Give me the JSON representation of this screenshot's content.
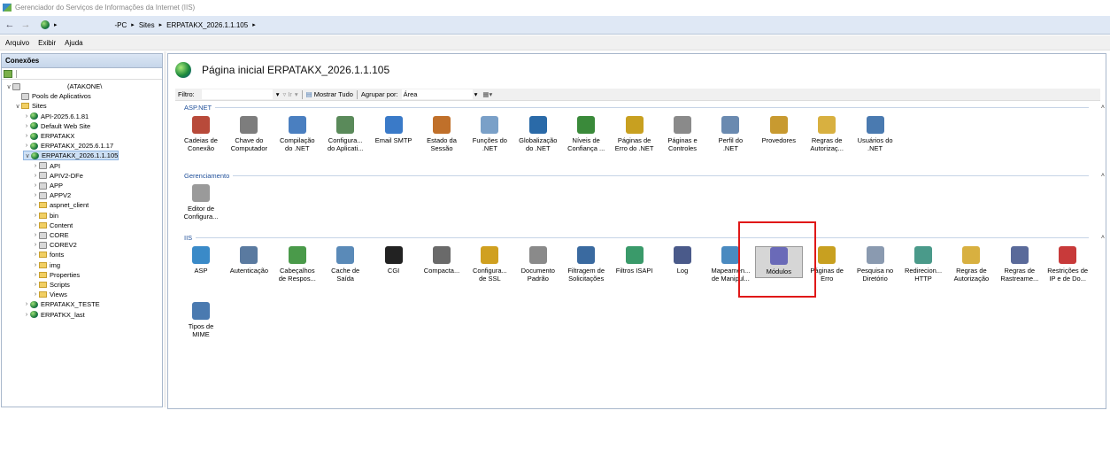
{
  "window": {
    "title": "Gerenciador do Serviços de Informações da Internet (IIS)"
  },
  "address": {
    "crumbs": [
      "-PC",
      "Sites",
      "ERPATAKX_2026.1.1.105"
    ]
  },
  "menu": [
    "Arquivo",
    "Exibir",
    "Ajuda"
  ],
  "connections": {
    "header": "Conexões",
    "tree": [
      {
        "label": "(ATAKONE\\",
        "indent": 0,
        "tog": "v",
        "icon": "server-icon"
      },
      {
        "label": "Pools de Aplicativos",
        "indent": 1,
        "tog": "",
        "icon": "app-pool-icon"
      },
      {
        "label": "Sites",
        "indent": 1,
        "tog": "v",
        "icon": "sites-folder-icon"
      },
      {
        "label": "API-2025.6.1.81",
        "indent": 2,
        "tog": ">",
        "icon": "globe-icon"
      },
      {
        "label": "Default Web Site",
        "indent": 2,
        "tog": ">",
        "icon": "globe-icon"
      },
      {
        "label": "ERPATAKX",
        "indent": 2,
        "tog": ">",
        "icon": "globe-icon"
      },
      {
        "label": "ERPATAKX_2025.6.1.17",
        "indent": 2,
        "tog": ">",
        "icon": "globe-icon"
      },
      {
        "label": "ERPATAKX_2026.1.1.105",
        "indent": 2,
        "tog": "v",
        "icon": "globe-icon",
        "selected": true
      },
      {
        "label": "API",
        "indent": 3,
        "tog": ">",
        "icon": "app-icon"
      },
      {
        "label": "APIV2-DFe",
        "indent": 3,
        "tog": ">",
        "icon": "app-icon"
      },
      {
        "label": "APP",
        "indent": 3,
        "tog": ">",
        "icon": "app-icon"
      },
      {
        "label": "APPV2",
        "indent": 3,
        "tog": ">",
        "icon": "app-icon"
      },
      {
        "label": "aspnet_client",
        "indent": 3,
        "tog": ">",
        "icon": "folder-icon"
      },
      {
        "label": "bin",
        "indent": 3,
        "tog": ">",
        "icon": "folder-icon"
      },
      {
        "label": "Content",
        "indent": 3,
        "tog": ">",
        "icon": "folder-icon"
      },
      {
        "label": "CORE",
        "indent": 3,
        "tog": ">",
        "icon": "app-icon"
      },
      {
        "label": "COREV2",
        "indent": 3,
        "tog": ">",
        "icon": "app-icon"
      },
      {
        "label": "fonts",
        "indent": 3,
        "tog": ">",
        "icon": "folder-icon"
      },
      {
        "label": "img",
        "indent": 3,
        "tog": ">",
        "icon": "folder-icon"
      },
      {
        "label": "Properties",
        "indent": 3,
        "tog": ">",
        "icon": "folder-icon"
      },
      {
        "label": "Scripts",
        "indent": 3,
        "tog": ">",
        "icon": "folder-icon"
      },
      {
        "label": "Views",
        "indent": 3,
        "tog": ">",
        "icon": "folder-icon"
      },
      {
        "label": "ERPATAKX_TESTE",
        "indent": 2,
        "tog": ">",
        "icon": "globe-icon"
      },
      {
        "label": "ERPATKX_last",
        "indent": 2,
        "tog": ">",
        "icon": "globe-icon"
      }
    ]
  },
  "main": {
    "title": "Página inicial ERPATAKX_2026.1.1.105",
    "filter": {
      "label": "Filtro:",
      "go": "Ir",
      "show_all": "Mostrar Tudo",
      "group_by": "Agrupar por:",
      "group_value": "Área"
    },
    "groups": [
      {
        "name": "ASP.NET",
        "features": [
          {
            "label": "Cadeias de\nConexão",
            "icon": "connection-strings-icon",
            "color": "#b84a3a"
          },
          {
            "label": "Chave do\nComputador",
            "icon": "machine-key-icon",
            "color": "#7d7d7d"
          },
          {
            "label": "Compilação\ndo .NET",
            "icon": "compilation-icon",
            "color": "#4a7fc0"
          },
          {
            "label": "Configura...\ndo Aplicati...",
            "icon": "app-settings-icon",
            "color": "#5a8a5a"
          },
          {
            "label": "Email SMTP",
            "icon": "smtp-email-icon",
            "color": "#3a7ac8"
          },
          {
            "label": "Estado da\nSessão",
            "icon": "session-state-icon",
            "color": "#c0702a"
          },
          {
            "label": "Funções do\n.NET",
            "icon": "net-roles-icon",
            "color": "#7aa0c8"
          },
          {
            "label": "Globalização\ndo .NET",
            "icon": "globalization-icon",
            "color": "#2a6aa8"
          },
          {
            "label": "Níveis de\nConfiança ...",
            "icon": "trust-levels-icon",
            "color": "#3a8a3a"
          },
          {
            "label": "Páginas de\nErro do .NET",
            "icon": "error-pages-net-icon",
            "color": "#c8a020"
          },
          {
            "label": "Páginas e\nControles",
            "icon": "pages-controls-icon",
            "color": "#8a8a8a"
          },
          {
            "label": "Perfil do\n.NET",
            "icon": "profile-icon",
            "color": "#6a8ab0"
          },
          {
            "label": "Provedores",
            "icon": "providers-icon",
            "color": "#c89a30"
          },
          {
            "label": "Regras de\nAutorizaç...",
            "icon": "authorization-rules-icon",
            "color": "#d8b040"
          },
          {
            "label": "Usuários do\n.NET",
            "icon": "net-users-icon",
            "color": "#4a7ab0"
          }
        ]
      },
      {
        "name": "Gerenciamento",
        "features": [
          {
            "label": "Editor de\nConfigura...",
            "icon": "config-editor-icon",
            "color": "#9a9a9a"
          }
        ]
      },
      {
        "name": "IIS",
        "features": [
          {
            "label": "ASP",
            "icon": "asp-icon",
            "color": "#3a8ac8"
          },
          {
            "label": "Autenticação",
            "icon": "authentication-icon",
            "color": "#5a7aa0"
          },
          {
            "label": "Cabeçalhos\nde Respos...",
            "icon": "response-headers-icon",
            "color": "#4a9a4a"
          },
          {
            "label": "Cache de\nSaída",
            "icon": "output-cache-icon",
            "color": "#5a8ab8"
          },
          {
            "label": "CGI",
            "icon": "cgi-icon",
            "color": "#222222"
          },
          {
            "label": "Compacta...",
            "icon": "compression-icon",
            "color": "#6a6a6a"
          },
          {
            "label": "Configura...\nde SSL",
            "icon": "ssl-settings-icon",
            "color": "#d0a020"
          },
          {
            "label": "Documento\nPadrão",
            "icon": "default-document-icon",
            "color": "#8a8a8a"
          },
          {
            "label": "Filtragem de\nSolicitações",
            "icon": "request-filtering-icon",
            "color": "#3a6aa0"
          },
          {
            "label": "Filtros ISAPI",
            "icon": "isapi-filters-icon",
            "color": "#3a9a6a"
          },
          {
            "label": "Log",
            "icon": "log-icon",
            "color": "#4a5a8a"
          },
          {
            "label": "Mapeamen...\nde Manipul...",
            "icon": "handler-mappings-icon",
            "color": "#4a8ac0"
          },
          {
            "label": "Módulos",
            "icon": "modules-icon",
            "color": "#6a6ab8",
            "selected": true
          },
          {
            "label": "Páginas de\nErro",
            "icon": "error-pages-icon",
            "color": "#c8a020"
          },
          {
            "label": "Pesquisa no\nDiretório",
            "icon": "directory-browsing-icon",
            "color": "#8a9ab0"
          },
          {
            "label": "Redirecion...\nHTTP",
            "icon": "http-redirect-icon",
            "color": "#4a9a8a"
          },
          {
            "label": "Regras de\nAutorização",
            "icon": "iis-authorization-icon",
            "color": "#d8b040"
          },
          {
            "label": "Regras de\nRastreame...",
            "icon": "failed-request-tracing-icon",
            "color": "#5a6a9a"
          },
          {
            "label": "Restrições de\nIP e de Do...",
            "icon": "ip-restrictions-icon",
            "color": "#c83a3a"
          },
          {
            "label": "Tipos de\nMIME",
            "icon": "mime-types-icon",
            "color": "#4a7ab0"
          }
        ]
      }
    ]
  }
}
